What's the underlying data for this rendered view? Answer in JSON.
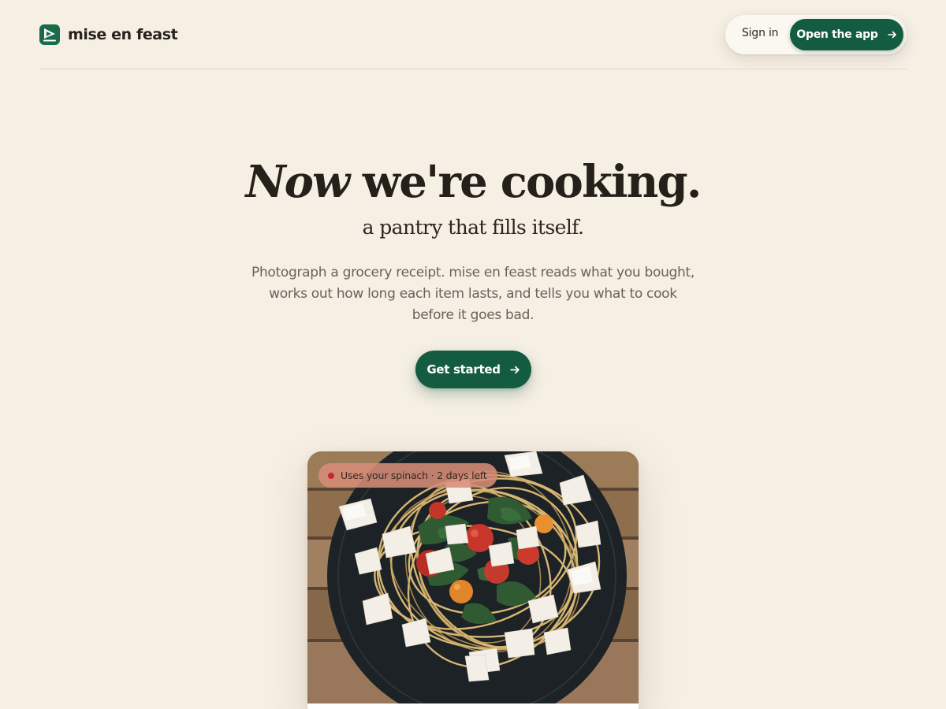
{
  "brand": {
    "name": "mise en feast",
    "icon": "pantry-logo-icon",
    "color": "#1a6b4c"
  },
  "nav": {
    "signin_label": "Sign in",
    "open_app_label": "Open the app",
    "accent": "#145c41"
  },
  "hero": {
    "title_emphasis": "Now",
    "title_rest": " we're cooking.",
    "subtitle": "a pantry that fills itself.",
    "body": "Photograph a grocery receipt. mise en feast reads what you bought, works out how long each item lasts, and tells you what to cook before it goes bad.",
    "cta_label": "Get started"
  },
  "card": {
    "badge_text": "Uses your spinach · 2 days left",
    "badge_dot_color": "#c8262e",
    "photo": "spaghetti-with-spinach-tomatoes-parmesan"
  }
}
